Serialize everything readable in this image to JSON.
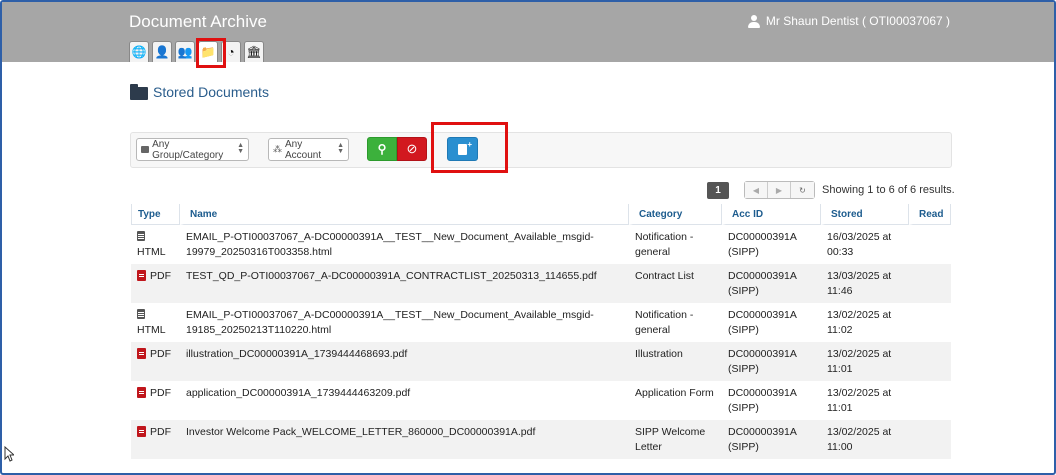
{
  "app": {
    "title": "Document Archive",
    "user": "Mr Shaun Dentist ( OTI00037067 )"
  },
  "nav_tabs": [
    {
      "name": "globe-icon",
      "glyph": "🌐"
    },
    {
      "name": "contact-card-icon",
      "glyph": "👤"
    },
    {
      "name": "user-add-icon",
      "glyph": "👥"
    },
    {
      "name": "folder-icon",
      "glyph": "📁"
    },
    {
      "name": "pie-chart-icon",
      "glyph": "◔"
    },
    {
      "name": "bank-icon",
      "glyph": "🏛"
    }
  ],
  "page": {
    "title": "Stored Documents"
  },
  "filters": {
    "group": "Any Group/Category",
    "account": "Any Account"
  },
  "pagination": {
    "current": "1",
    "results": "Showing 1 to 6 of 6 results."
  },
  "table": {
    "headers": {
      "type": "Type",
      "name": "Name",
      "category": "Category",
      "acc": "Acc ID",
      "stored": "Stored",
      "read": "Read"
    },
    "rows": [
      {
        "type": "HTML",
        "name": "EMAIL_P-OTI00037067_A-DC00000391A__TEST__New_Document_Available_msgid-19979_20250316T003358.html",
        "category": "Notification - general",
        "acc": "DC00000391A (SIPP)",
        "stored": "16/03/2025 at 00:33"
      },
      {
        "type": "PDF",
        "name": "TEST_QD_P-OTI00037067_A-DC00000391A_CONTRACTLIST_20250313_114655.pdf",
        "category": "Contract List",
        "acc": "DC00000391A (SIPP)",
        "stored": "13/03/2025 at 11:46"
      },
      {
        "type": "HTML",
        "name": "EMAIL_P-OTI00037067_A-DC00000391A__TEST__New_Document_Available_msgid-19185_20250213T110220.html",
        "category": "Notification - general",
        "acc": "DC00000391A (SIPP)",
        "stored": "13/02/2025 at 11:02"
      },
      {
        "type": "PDF",
        "name": "illustration_DC00000391A_1739444468693.pdf",
        "category": "Illustration",
        "acc": "DC00000391A (SIPP)",
        "stored": "13/02/2025 at 11:01"
      },
      {
        "type": "PDF",
        "name": "application_DC00000391A_1739444463209.pdf",
        "category": "Application Form",
        "acc": "DC00000391A (SIPP)",
        "stored": "13/02/2025 at 11:01"
      },
      {
        "type": "PDF",
        "name": "Investor Welcome Pack_WELCOME_LETTER_860000_DC00000391A.pdf",
        "category": "SIPP Welcome Letter",
        "acc": "DC00000391A (SIPP)",
        "stored": "13/02/2025 at 11:00"
      }
    ]
  }
}
